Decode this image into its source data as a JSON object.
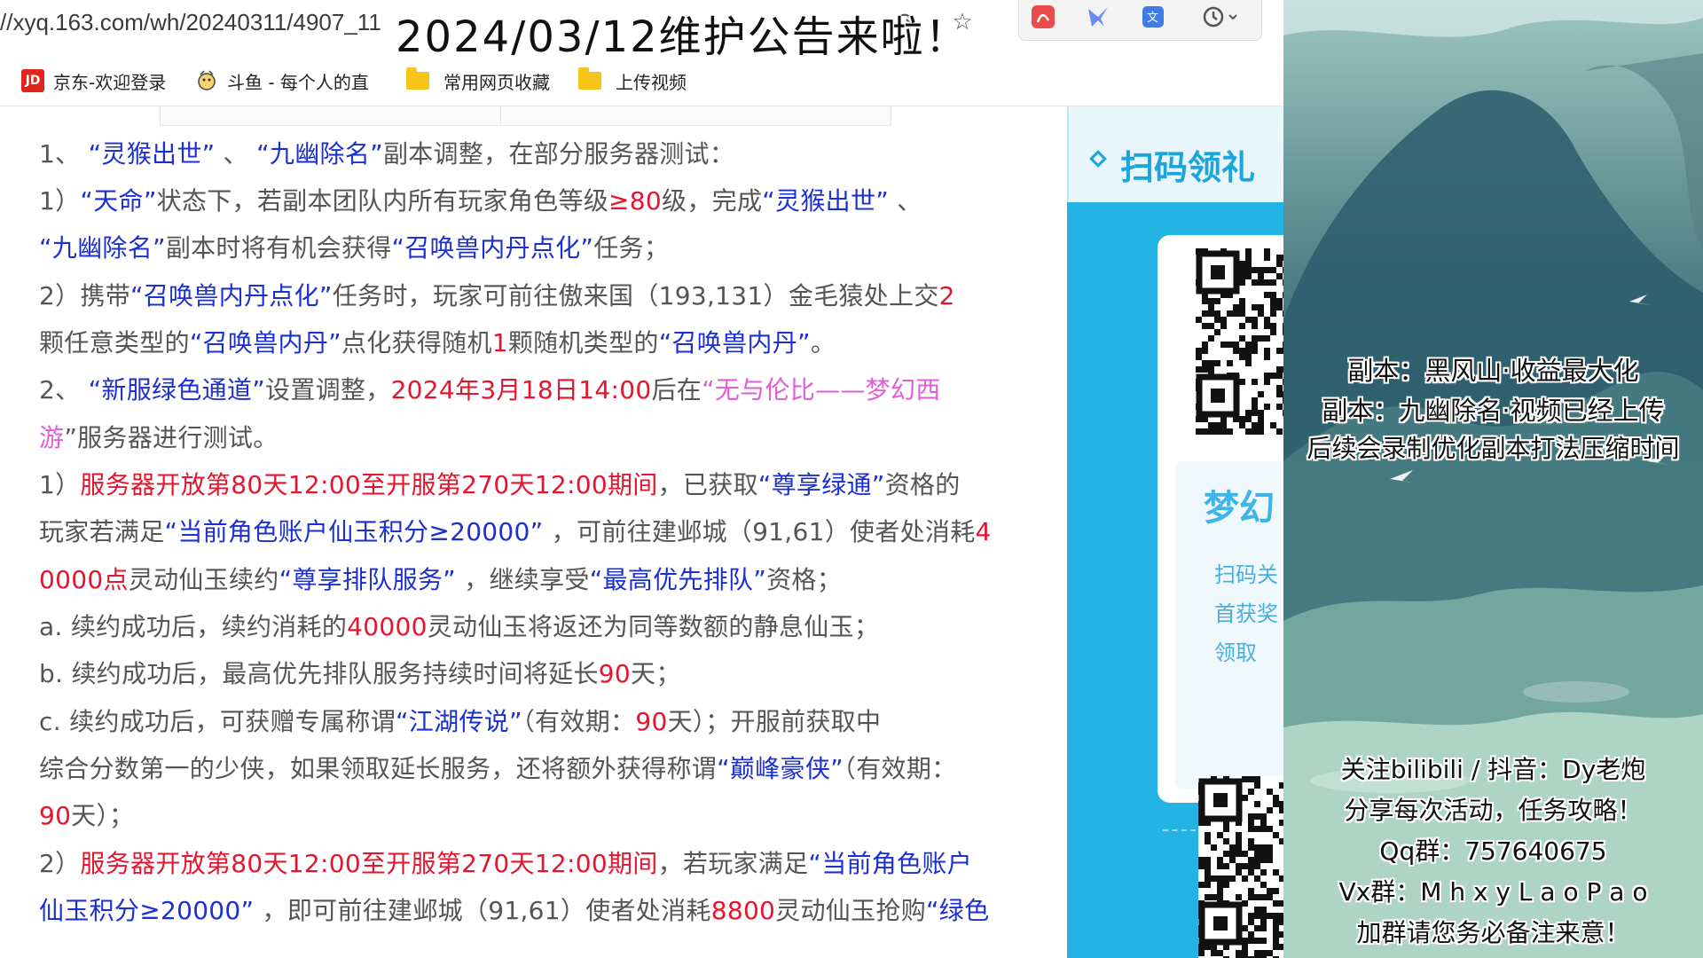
{
  "browser": {
    "url": "//xyq.163.com/wh/20240311/4907_11",
    "overlay_title": "2024/03/12维护公告来啦！",
    "bookmarks": [
      {
        "label": "京东-欢迎登录",
        "icon": "jd-logo-icon"
      },
      {
        "label": "斗鱼 - 每个人的直",
        "icon": "douyu-logo-icon"
      },
      {
        "label": "常用网页收藏",
        "icon": "folder-icon"
      },
      {
        "label": "上传视频",
        "icon": "folder-icon"
      }
    ],
    "toolbar_icons": [
      "share-icon",
      "star-icon",
      "pdf-icon",
      "translate-icon",
      "screenshot-icon",
      "history-icon"
    ]
  },
  "article": {
    "lines": [
      [
        [
          "t",
          "1、 "
        ],
        [
          "q",
          "“灵猴出世”"
        ],
        [
          "t",
          " 、 "
        ],
        [
          "q",
          "“九幽除名”"
        ],
        [
          "t",
          "副本调整，在部分服务器测试："
        ]
      ],
      [
        [
          "t",
          "    1）"
        ],
        [
          "q",
          "“天命”"
        ],
        [
          "t",
          "状态下，若副本团队内所有玩家角色等级"
        ],
        [
          "r",
          "≥80"
        ],
        [
          "t",
          "级，完成"
        ],
        [
          "q",
          "“灵猴出世”"
        ],
        [
          "t",
          " 、"
        ]
      ],
      [
        [
          "q",
          "“九幽除名”"
        ],
        [
          "t",
          "副本时将有机会获得"
        ],
        [
          "q",
          "“召唤兽内丹点化”"
        ],
        [
          "t",
          "任务；"
        ]
      ],
      [
        [
          "t",
          "    2）携带"
        ],
        [
          "q",
          "“召唤兽内丹点化”"
        ],
        [
          "t",
          "任务时，玩家可前往傲来国（193,131）金毛猿处上交"
        ],
        [
          "r",
          "2"
        ]
      ],
      [
        [
          "t",
          "颗任意类型的"
        ],
        [
          "q",
          "“召唤兽内丹”"
        ],
        [
          "t",
          "点化获得随机"
        ],
        [
          "r",
          "1"
        ],
        [
          "t",
          "颗随机类型的"
        ],
        [
          "q",
          "“召唤兽内丹”"
        ],
        [
          "t",
          "。"
        ]
      ],
      [
        [
          "t",
          "2、 "
        ],
        [
          "q",
          "“新服绿色通道”"
        ],
        [
          "t",
          "设置调整，"
        ],
        [
          "r",
          "2024年3月18日14:00"
        ],
        [
          "t",
          "后在"
        ],
        [
          "p",
          "“无与伦比——梦幻西"
        ]
      ],
      [
        [
          "p",
          "游"
        ],
        [
          "t",
          "”服务器进行测试。"
        ]
      ],
      [
        [
          "t",
          "    1）"
        ],
        [
          "r",
          "服务器开放第80天12:00至开服第270天12:00期间"
        ],
        [
          "t",
          "，已获取"
        ],
        [
          "q",
          "“尊享绿通”"
        ],
        [
          "t",
          "资格的"
        ]
      ],
      [
        [
          "t",
          "玩家若满足"
        ],
        [
          "q",
          "“当前角色账户仙玉积分≥20000”"
        ],
        [
          "t",
          " ，可前往建邺城（91,61）使者处消耗"
        ],
        [
          "r",
          "4"
        ]
      ],
      [
        [
          "r",
          "0000点"
        ],
        [
          "t",
          "灵动仙玉续约"
        ],
        [
          "q",
          "“尊享排队服务”"
        ],
        [
          "t",
          " ，继续享受"
        ],
        [
          "q",
          "“最高优先排队”"
        ],
        [
          "t",
          "资格；"
        ]
      ],
      [
        [
          "t",
          "        a. 续约成功后，续约消耗的"
        ],
        [
          "r",
          "40000"
        ],
        [
          "t",
          "灵动仙玉将返还为同等数额的静息仙玉；"
        ]
      ],
      [
        [
          "t",
          "        b. 续约成功后，最高优先排队服务持续时间将延长"
        ],
        [
          "r",
          "90"
        ],
        [
          "t",
          "天；"
        ]
      ],
      [
        [
          "t",
          "        c. 续约成功后，可获赠专属称谓"
        ],
        [
          "q",
          "“江湖传说”"
        ],
        [
          "t",
          "（有效期："
        ],
        [
          "r",
          "90"
        ],
        [
          "t",
          "天）；开服前获取中"
        ]
      ],
      [
        [
          "t",
          "综合分数第一的少侠，如果领取延长服务，还将额外获得称谓"
        ],
        [
          "q",
          "“巅峰豪侠”"
        ],
        [
          "t",
          "（有效期："
        ]
      ],
      [
        [
          "r",
          "90"
        ],
        [
          "t",
          "天）；"
        ]
      ],
      [
        [
          "t",
          "    2）"
        ],
        [
          "r",
          "服务器开放第80天12:00至开服第270天12:00期间"
        ],
        [
          "t",
          "，若玩家满足"
        ],
        [
          "q",
          "“当前角色账户"
        ]
      ],
      [
        [
          "q",
          "仙玉积分≥20000”"
        ],
        [
          "t",
          " ，即可前往建邺城（91,61）使者处消耗"
        ],
        [
          "r",
          "8800"
        ],
        [
          "t",
          "灵动仙玉抢购"
        ],
        [
          "q",
          "“绿色"
        ]
      ]
    ]
  },
  "sidebar": {
    "header_title": "扫码领礼",
    "brand": "梦幻",
    "lines": [
      "扫码关",
      "首获奖",
      "领取"
    ]
  },
  "overlay": {
    "top_lines": [
      "副本：黑风山·收益最大化",
      "副本：九幽除名·视频已经上传",
      "后续会录制优化副本打法压缩时间"
    ],
    "bottom_lines": [
      "关注bilibili / 抖音：Dy老炮",
      "分享每次活动，任务攻略！",
      "Qq群：757640675",
      "Vx群：M h x y L a o P a o",
      "加群请您务必备注来意！"
    ]
  },
  "colors": {
    "link_blue": "#1c2fd0",
    "highlight_red": "#e5152e",
    "pink": "#e05ed8",
    "body_text": "#555555",
    "sidebar_blue": "#23b4e3"
  }
}
